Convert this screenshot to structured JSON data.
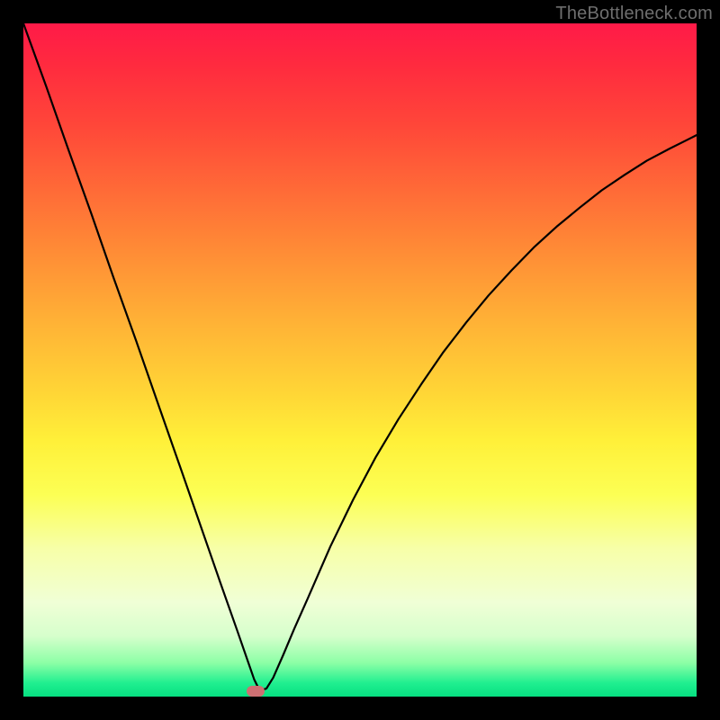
{
  "watermark": {
    "text": "TheBottleneck.com"
  },
  "chart_data": {
    "type": "line",
    "title": "",
    "xlabel": "",
    "ylabel": "",
    "xlim": [
      0,
      100
    ],
    "ylim": [
      0,
      100
    ],
    "grid": false,
    "legend": false,
    "background_gradient": {
      "orientation": "vertical",
      "stops": [
        {
          "pos": 0.0,
          "color": "#ff1a48"
        },
        {
          "pos": 0.35,
          "color": "#ff9036"
        },
        {
          "pos": 0.62,
          "color": "#fff039"
        },
        {
          "pos": 0.86,
          "color": "#f0ffd6"
        },
        {
          "pos": 1.0,
          "color": "#06e081"
        }
      ]
    },
    "series": [
      {
        "name": "bottleneck-curve",
        "color": "#000000",
        "x": [
          0.0,
          3.4,
          6.7,
          10.1,
          13.4,
          16.8,
          20.0,
          23.5,
          26.8,
          29.3,
          31.8,
          33.5,
          34.3,
          35.1,
          36.1,
          37.1,
          38.6,
          40.2,
          42.2,
          45.6,
          49.0,
          52.3,
          55.7,
          59.1,
          62.4,
          65.8,
          69.1,
          72.5,
          75.8,
          79.2,
          82.6,
          85.9,
          89.3,
          92.6,
          96.0,
          100.0
        ],
        "y": [
          100.0,
          90.6,
          81.2,
          71.7,
          62.2,
          52.7,
          43.5,
          33.5,
          24.0,
          16.8,
          9.7,
          4.8,
          2.5,
          0.9,
          1.2,
          2.8,
          6.2,
          10.0,
          14.5,
          22.3,
          29.3,
          35.5,
          41.2,
          46.4,
          51.2,
          55.6,
          59.6,
          63.3,
          66.7,
          69.8,
          72.6,
          75.2,
          77.5,
          79.6,
          81.4,
          83.4
        ]
      }
    ],
    "markers": [
      {
        "name": "optimal-point",
        "x": 34.5,
        "y": 0.8,
        "color": "#cd6f72",
        "shape": "pill"
      }
    ]
  }
}
